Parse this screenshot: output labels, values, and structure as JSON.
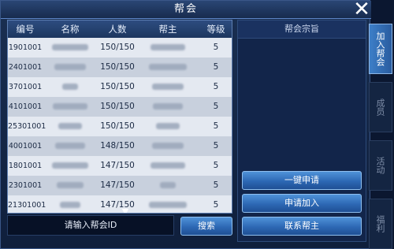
{
  "window": {
    "title": "帮会",
    "close_label": "✕"
  },
  "table": {
    "headers": [
      "编号",
      "名称",
      "人数",
      "帮主",
      "等级"
    ],
    "rows": [
      {
        "id": "1901001",
        "members": "150/150",
        "level": "5"
      },
      {
        "id": "2401001",
        "members": "150/150",
        "level": "5"
      },
      {
        "id": "3701001",
        "members": "150/150",
        "level": "5"
      },
      {
        "id": "4101001",
        "members": "150/150",
        "level": "5"
      },
      {
        "id": "25301001",
        "members": "150/150",
        "level": "5"
      },
      {
        "id": "4001001",
        "members": "148/150",
        "level": "5"
      },
      {
        "id": "1801001",
        "members": "147/150",
        "level": "5"
      },
      {
        "id": "2301001",
        "members": "147/150",
        "level": "5"
      },
      {
        "id": "21301001",
        "members": "147/150",
        "level": "5"
      }
    ],
    "scroll_icon": "chevron-down"
  },
  "search": {
    "placeholder": "请输入帮会ID",
    "button_label": "搜索"
  },
  "panel": {
    "title": "帮会宗旨"
  },
  "actions": {
    "quick_apply": "一键申请",
    "apply_join": "申请加入",
    "contact_leader": "联系帮主"
  },
  "side_tabs": [
    "加入帮会",
    "成员",
    "活动",
    "福利"
  ],
  "colors": {
    "accent": "#2d68b4",
    "active_tab": "#3d7fc8",
    "background": "#0b1730"
  }
}
